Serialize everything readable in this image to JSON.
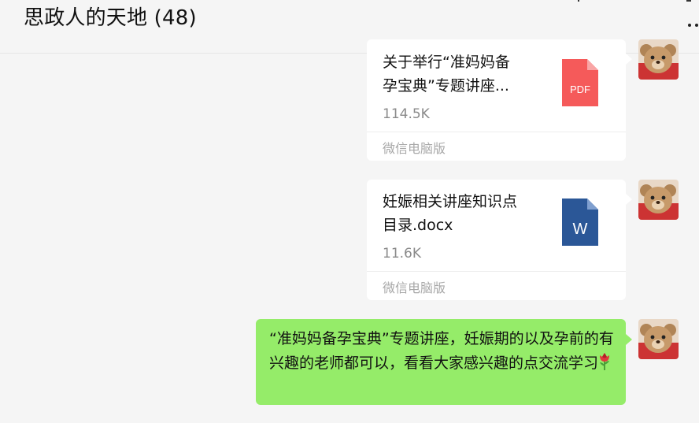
{
  "header": {
    "title": "思政人的天地 (48)"
  },
  "messages": [
    {
      "type": "file",
      "file_name": "关于举行“准妈妈备孕宝典”专题讲座...",
      "file_name_line1": "关于举行“准妈妈备",
      "file_name_line2": "孕宝典”专题讲座...",
      "file_size": "114.5K",
      "source": "微信电脑版",
      "icon": "pdf-file-icon",
      "icon_label": "PDF",
      "icon_color": "#f55a5a"
    },
    {
      "type": "file",
      "file_name_line1": "妊娠相关讲座知识点",
      "file_name_line2": "目录.docx",
      "file_size": "11.6K",
      "source": "微信电脑版",
      "icon": "word-file-icon",
      "icon_label": "W",
      "icon_color": "#2b5797"
    },
    {
      "type": "text",
      "text": "“准妈妈备孕宝典”专题讲座，妊娠期的以及孕前的有兴趣的老师都可以，看看大家感兴趣的点交流学习",
      "emoji": "rose-emoji",
      "bubble_color": "#95ec69"
    }
  ],
  "colors": {
    "background": "#f5f5f5",
    "self_bubble": "#95ec69",
    "card": "#ffffff"
  }
}
